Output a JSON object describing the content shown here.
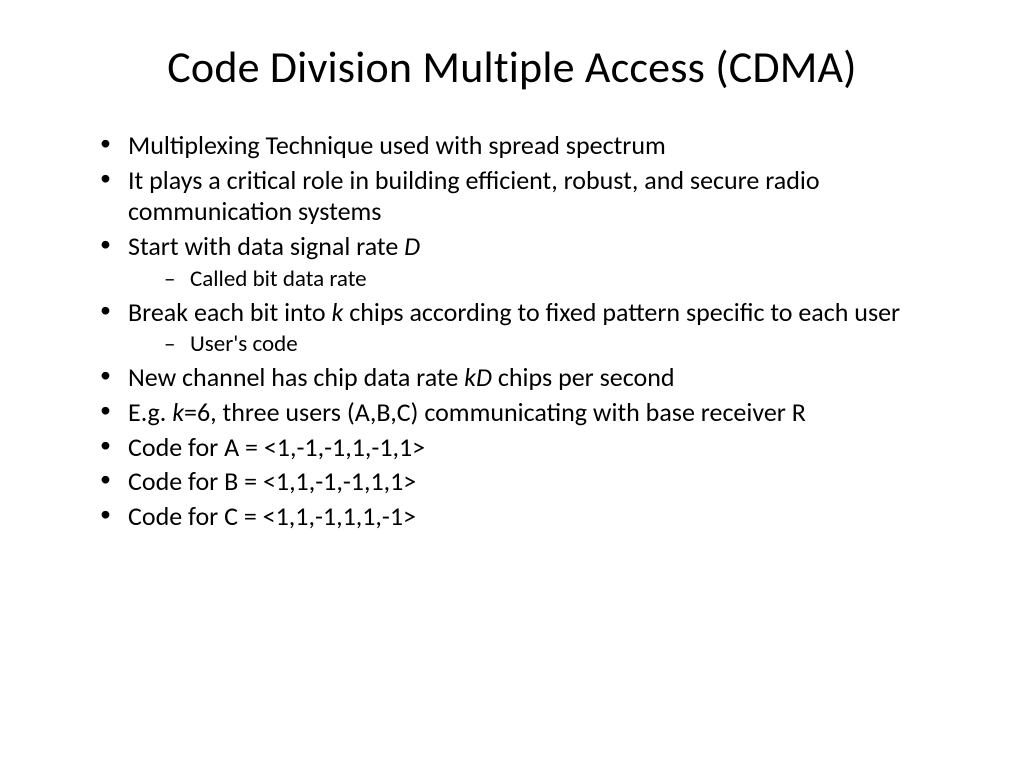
{
  "title": "Code Division Multiple Access (CDMA)",
  "bullets": {
    "b1": "Multiplexing Technique used with spread spectrum",
    "b2": "It plays a critical role in building efficient, robust, and secure radio communication systems",
    "b3_pre": "Start with data signal rate ",
    "b3_it": "D",
    "b3_sub": "Called bit data rate",
    "b4_pre": "Break each bit into ",
    "b4_it": "k",
    "b4_post": " chips according to fixed pattern specific to each user",
    "b4_sub": "User's code",
    "b5_pre": "New channel has chip data rate ",
    "b5_it": "kD",
    "b5_post": " chips per second",
    "b6_pre": "E.g. ",
    "b6_it": "k",
    "b6_post": "=6, three users (A,B,C) communicating with base receiver R",
    "b7": "Code for A = <1,-1,-1,1,-1,1>",
    "b8": "Code for B = <1,1,-1,-1,1,1>",
    "b9": "Code for C = <1,1,-1,1,1,-1>"
  }
}
